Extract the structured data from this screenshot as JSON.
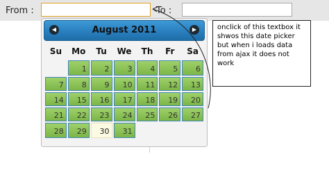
{
  "form": {
    "from_label": "From :",
    "from_value": "",
    "to_label": "To :",
    "to_value": ""
  },
  "datepicker": {
    "month_year": "August 2011",
    "prev_icon": "triangle-left-icon",
    "next_icon": "triangle-right-icon",
    "weekdays": [
      "Su",
      "Mo",
      "Tu",
      "We",
      "Th",
      "Fr",
      "Sa"
    ],
    "weeks": [
      [
        "",
        "1",
        "2",
        "3",
        "4",
        "5",
        "6"
      ],
      [
        "7",
        "8",
        "9",
        "10",
        "11",
        "12",
        "13"
      ],
      [
        "14",
        "15",
        "16",
        "17",
        "18",
        "19",
        "20"
      ],
      [
        "21",
        "22",
        "23",
        "24",
        "25",
        "26",
        "27"
      ],
      [
        "28",
        "29",
        "30",
        "31",
        "",
        "",
        ""
      ]
    ],
    "today": "30"
  },
  "note": {
    "text": "onclick of this textbox it shwos this date picker but when i loads data from ajax it does not work"
  },
  "colors": {
    "header": "#2a7fbf",
    "day_cell": "#8cc257",
    "day_border": "#3f86b8",
    "today_cell": "#fbfbe4",
    "input_focus": "#e0a020"
  }
}
